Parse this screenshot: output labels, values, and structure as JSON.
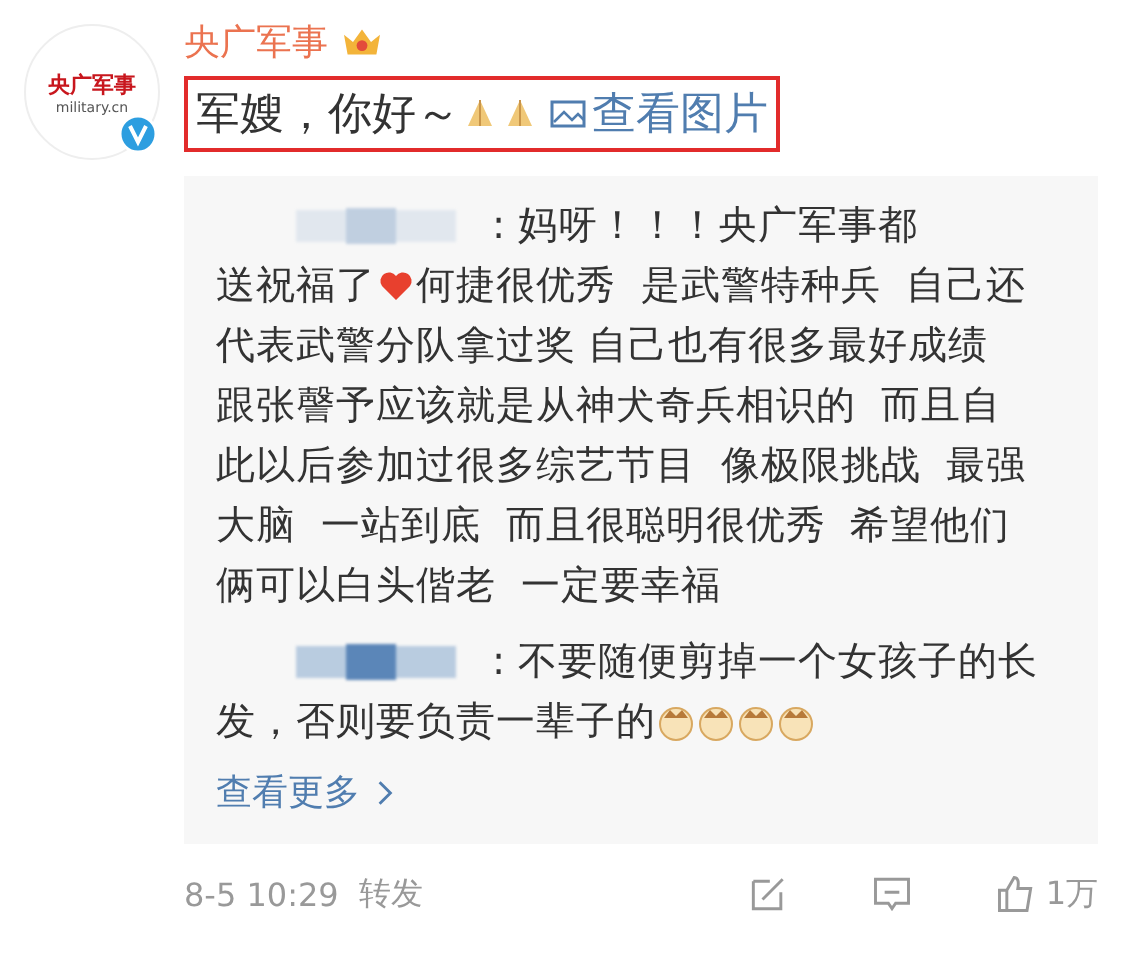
{
  "post": {
    "author": "央广军事",
    "avatar": {
      "title": "央广军事",
      "subtitle": "military.cn",
      "verified": true
    },
    "parts": [
      {
        "kind": "text",
        "text": "军嫂，你好～"
      },
      {
        "kind": "pray"
      },
      {
        "kind": "pray"
      },
      {
        "kind": "link",
        "text": "查看图片"
      }
    ],
    "highlighted": true
  },
  "replies": [
    {
      "name_blurred": true,
      "lines": [
        [
          {
            "kind": "text",
            "text": ": 妈呀！！！央广军事都"
          }
        ],
        [
          {
            "kind": "text",
            "text": "送祝福了"
          },
          {
            "kind": "heart"
          },
          {
            "kind": "text",
            "text": "何捷很优秀  是武警特种兵  自己还"
          }
        ],
        [
          {
            "kind": "text",
            "text": "代表武警分队拿过奖 自己也有很多最好成绩"
          }
        ],
        [
          {
            "kind": "text",
            "text": "跟张謦予应该就是从神犬奇兵相识的  而且自"
          }
        ],
        [
          {
            "kind": "text",
            "text": "此以后参加过很多综艺节目  像极限挑战  最强"
          }
        ],
        [
          {
            "kind": "text",
            "text": "大脑  一站到底  而且很聪明很优秀  希望他们"
          }
        ],
        [
          {
            "kind": "text",
            "text": "俩可以白头偕老  一定要幸福"
          }
        ]
      ]
    },
    {
      "name_blurred": true,
      "lines": [
        [
          {
            "kind": "text",
            "text": ": 不要随便剪掉一个女孩子的长"
          }
        ],
        [
          {
            "kind": "text",
            "text": "发，否则要负责一辈子的"
          },
          {
            "kind": "cat"
          },
          {
            "kind": "cat"
          },
          {
            "kind": "cat"
          },
          {
            "kind": "cat"
          }
        ]
      ]
    }
  ],
  "more": "查看更多",
  "footer": {
    "time": "8-5 10:29",
    "source": "转发",
    "likes": "1万"
  }
}
